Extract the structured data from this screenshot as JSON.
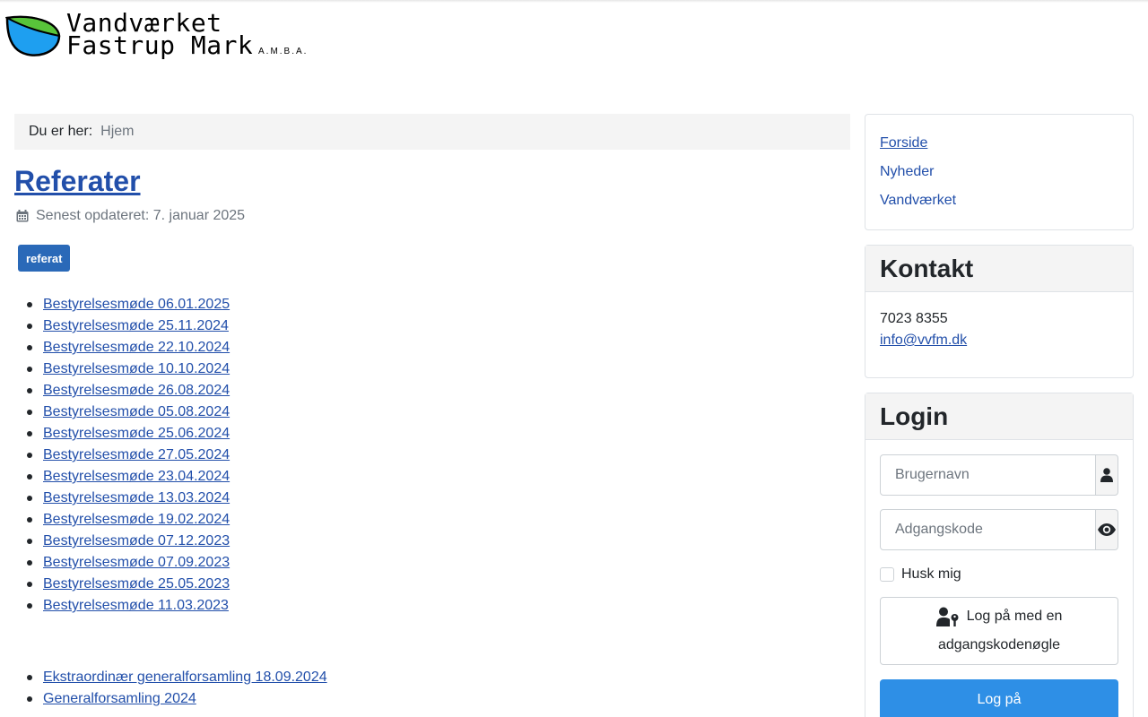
{
  "header": {
    "logo_line1": "Vandværket",
    "logo_line2": "Fastrup Mark",
    "logo_suffix": "A.M.B.A."
  },
  "breadcrumb": {
    "label": "Du er her:",
    "items": [
      "Hjem"
    ]
  },
  "article": {
    "title": "Referater",
    "updated": "Senest opdateret: 7. januar 2025",
    "tag": "referat",
    "minutes": [
      "Bestyrelsesmøde 06.01.2025",
      "Bestyrelsesmøde 25.11.2024",
      "Bestyrelsesmøde 22.10.2024",
      "Bestyrelsesmøde 10.10.2024",
      "Bestyrelsesmøde 26.08.2024",
      "Bestyrelsesmøde 05.08.2024",
      "Bestyrelsesmøde 25.06.2024",
      "Bestyrelsesmøde 27.05.2024",
      "Bestyrelsesmøde 23.04.2024",
      "Bestyrelsesmøde 13.03.2024",
      "Bestyrelsesmøde 19.02.2024",
      "Bestyrelsesmøde 07.12.2023",
      "Bestyrelsesmøde 07.09.2023",
      "Bestyrelsesmøde 25.05.2023",
      "Bestyrelsesmøde 11.03.2023"
    ],
    "assemblies": [
      "Ekstraordinær generalforsamling 18.09.2024",
      "Generalforsamling 2024"
    ]
  },
  "sidebar": {
    "nav": [
      "Forside",
      "Nyheder",
      "Vandværket"
    ],
    "contact": {
      "title": "Kontakt",
      "phone": "7023 8355",
      "email": "info@vvfm.dk"
    },
    "login": {
      "title": "Login",
      "username_placeholder": "Brugernavn",
      "password_placeholder": "Adgangskode",
      "remember_label": "Husk mig",
      "passkey_label": "Log på med en adgangskodenøgle",
      "submit_label": "Log på"
    }
  },
  "colors": {
    "link": "#224faa",
    "tag_bg": "#2a69b8",
    "button_primary": "#2e8fe6",
    "leaf_blue": "#1e9ff0",
    "leaf_green": "#58c43a"
  },
  "icons": {
    "updated": "calendar-icon",
    "username": "user-icon",
    "password": "eye-icon",
    "passkey": "user-key-icon"
  }
}
